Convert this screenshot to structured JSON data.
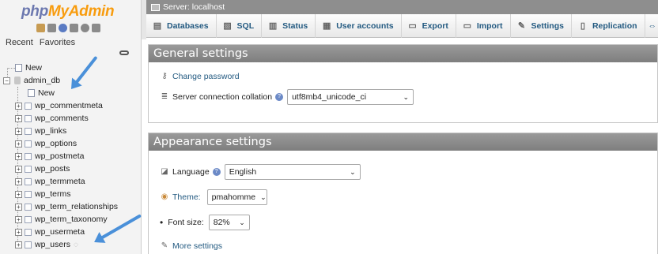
{
  "app": {
    "logo_php": "php",
    "logo_rest": "MyAdmin",
    "recent": "Recent",
    "favorites": "Favorites"
  },
  "tree": {
    "new_root": "New",
    "database": "admin_db",
    "new_table": "New",
    "tables": [
      "wp_commentmeta",
      "wp_comments",
      "wp_links",
      "wp_options",
      "wp_postmeta",
      "wp_posts",
      "wp_termmeta",
      "wp_terms",
      "wp_term_relationships",
      "wp_term_taxonomy",
      "wp_usermeta",
      "wp_users"
    ]
  },
  "server_bar": {
    "label": "Server: localhost"
  },
  "tabs": [
    {
      "label": "Databases",
      "icon": "databases-icon"
    },
    {
      "label": "SQL",
      "icon": "sql-icon"
    },
    {
      "label": "Status",
      "icon": "status-icon"
    },
    {
      "label": "User accounts",
      "icon": "users-icon"
    },
    {
      "label": "Export",
      "icon": "export-icon"
    },
    {
      "label": "Import",
      "icon": "import-icon"
    },
    {
      "label": "Settings",
      "icon": "settings-icon"
    },
    {
      "label": "Replication",
      "icon": "replication-icon"
    }
  ],
  "general": {
    "title": "General settings",
    "change_password": "Change password",
    "collation_label": "Server connection collation",
    "collation_value": "utf8mb4_unicode_ci"
  },
  "appearance": {
    "title": "Appearance settings",
    "language_label": "Language",
    "language_value": "English",
    "theme_label": "Theme:",
    "theme_value": "pmahomme",
    "font_size_label": "Font size:",
    "font_size_value": "82%",
    "more_settings": "More settings"
  },
  "colors": {
    "accent_link": "#235a81",
    "arrow": "#4a90d9",
    "panel_header": "#8a8a8a"
  }
}
